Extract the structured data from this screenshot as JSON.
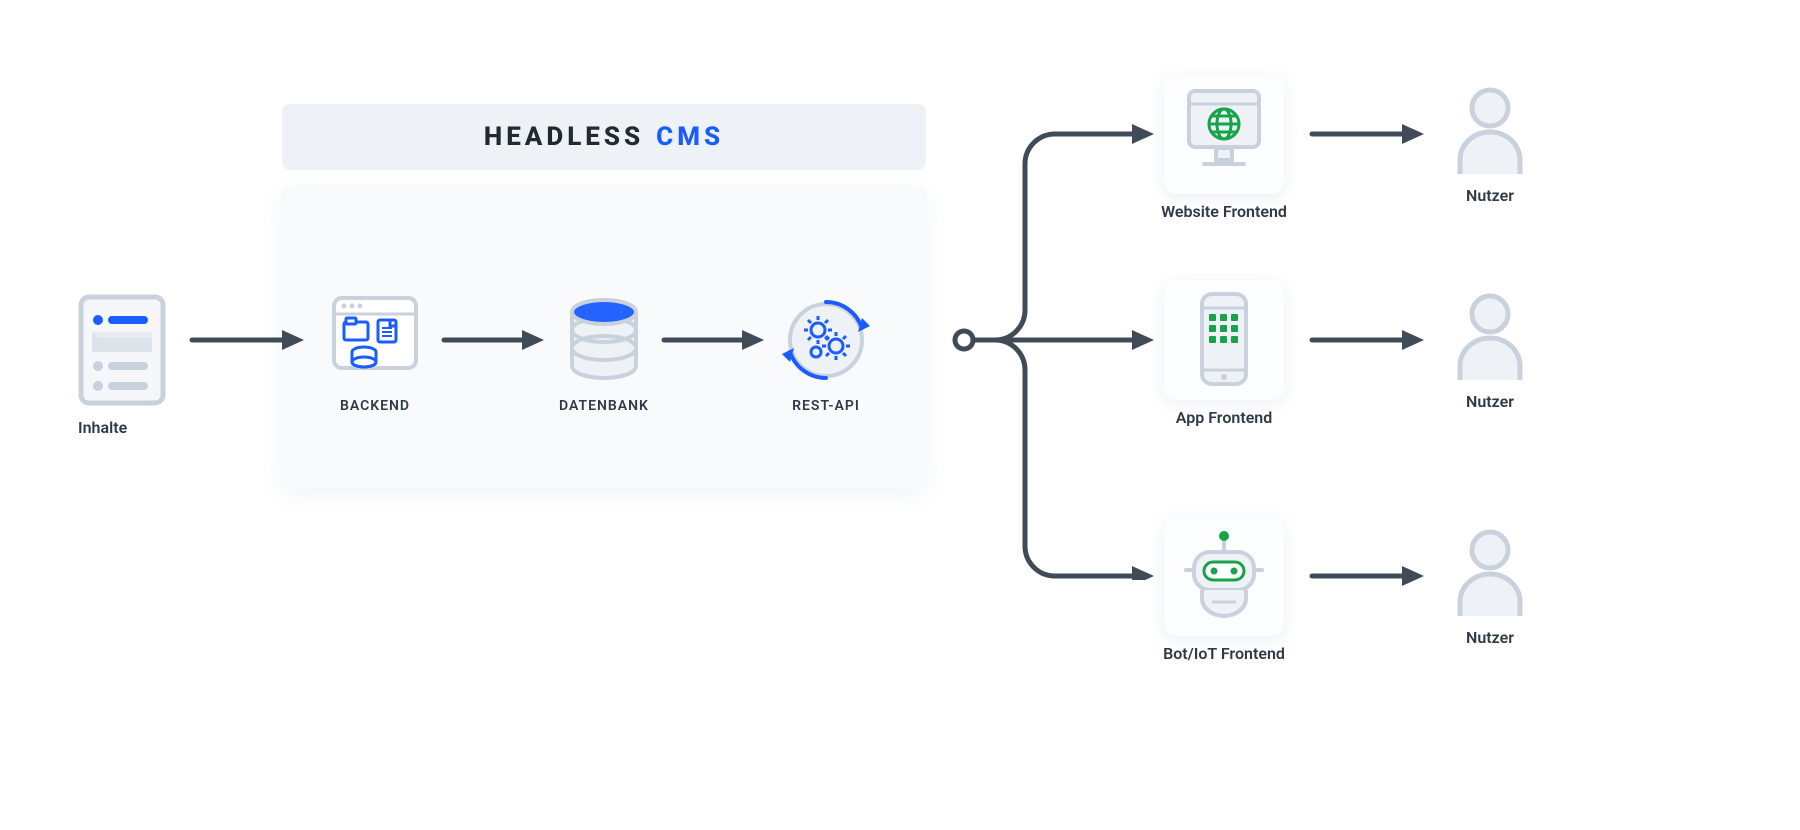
{
  "title": {
    "part1": "HEADLESS",
    "part2": "CMS"
  },
  "inputs": {
    "inhalte": "Inhalte"
  },
  "cms": {
    "backend": "BACKEND",
    "datenbank": "DATENBANK",
    "restapi": "REST-API"
  },
  "frontends": {
    "website": "Website Frontend",
    "app": "App Frontend",
    "bot": "Bot/IoT Frontend"
  },
  "user": "Nutzer",
  "colors": {
    "arrow": "#414b57",
    "stroke": "#c9d2dc",
    "fill": "#eef1f5",
    "blue": "#1b5cff",
    "blueFill": "#2363ff",
    "green": "#17a34a"
  }
}
